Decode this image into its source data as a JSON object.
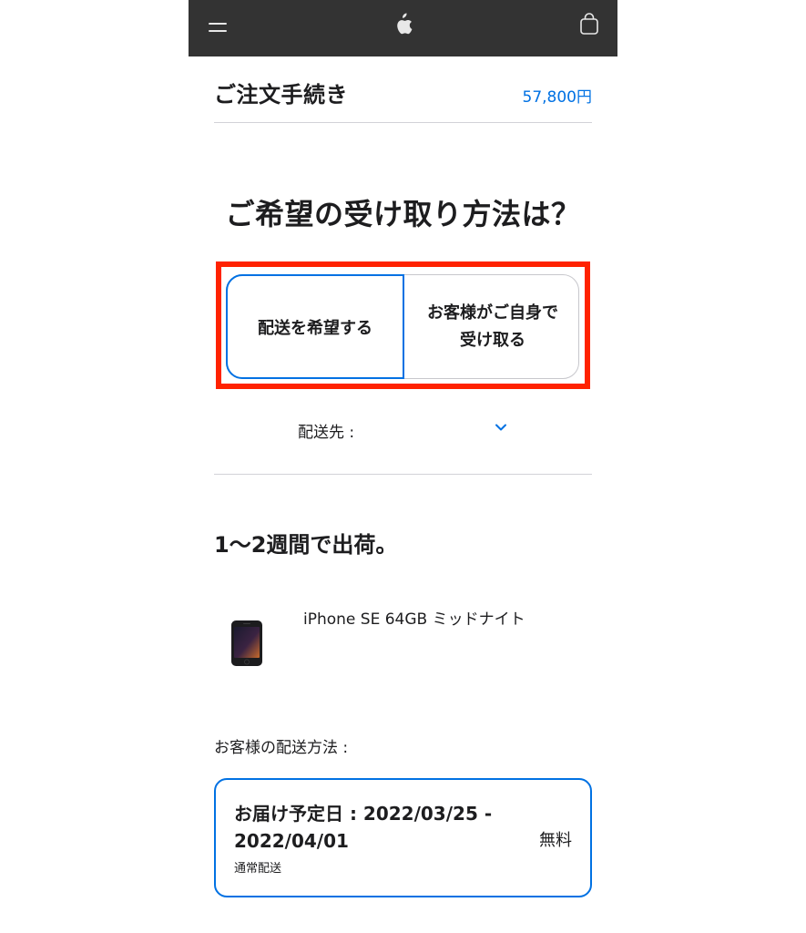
{
  "navbar": {
    "menu_icon": "hamburger-menu-icon",
    "logo_icon": "apple-logo-icon",
    "bag_icon": "shopping-bag-icon"
  },
  "order": {
    "title": "ご注文手続き",
    "total": "57,800円"
  },
  "question": "ご希望の受け取り方法は？",
  "options": {
    "delivery": "配送を希望する",
    "pickup": "お客様がご自身で受け取る"
  },
  "ship_to": {
    "label": "配送先 :",
    "chevron_icon": "chevron-down-icon"
  },
  "ship_time": "1〜2週間で出荷。",
  "product": {
    "name": "iPhone SE 64GB ミッドナイト"
  },
  "method": {
    "label": "お客様の配送方法 :",
    "date": "お届け予定日 : 2022/03/25 - 2022/04/01",
    "type": "通常配送",
    "price": "無料"
  },
  "colors": {
    "accent": "#0071e3",
    "navbar": "#333333",
    "highlight": "#ff2200"
  }
}
